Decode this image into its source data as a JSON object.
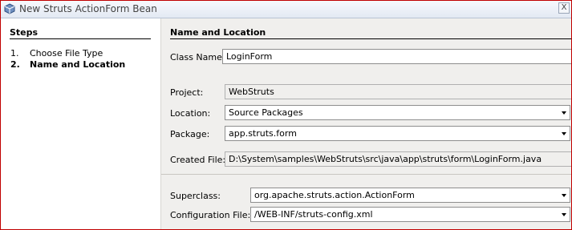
{
  "window": {
    "title": "New Struts ActionForm Bean",
    "close_glyph": "X",
    "accent_border": "#c00000"
  },
  "steps": {
    "heading": "Steps",
    "items": [
      {
        "num": "1.",
        "label": "Choose File Type",
        "active": false
      },
      {
        "num": "2.",
        "label": "Name and Location",
        "active": true
      }
    ]
  },
  "main": {
    "heading": "Name and Location",
    "class_name": {
      "label": "Class Name:",
      "value": "LoginForm"
    },
    "project": {
      "label": "Project:",
      "value": "WebStruts"
    },
    "location": {
      "label": "Location:",
      "value": "Source Packages"
    },
    "package": {
      "label": "Package:",
      "value": "app.struts.form"
    },
    "created_file": {
      "label": "Created File:",
      "value": "D:\\System\\samples\\WebStruts\\src\\java\\app\\struts\\form\\LoginForm.java"
    },
    "superclass": {
      "label": "Superclass:",
      "value": "org.apache.struts.action.ActionForm"
    },
    "config_file": {
      "label": "Configuration File:",
      "value": "/WEB-INF/struts-config.xml"
    }
  },
  "icons": {
    "app": "cube-icon",
    "close": "close-icon",
    "dropdown": "chevron-down-icon"
  }
}
